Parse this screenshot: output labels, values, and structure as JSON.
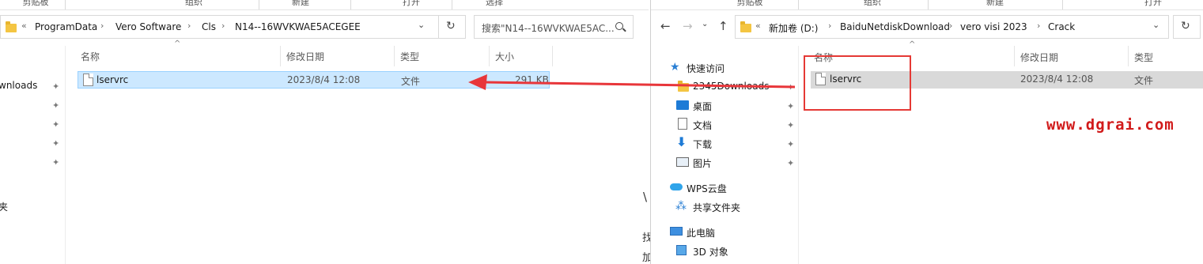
{
  "left_window": {
    "ribbon": [
      "剪贴板",
      "组织",
      "新建",
      "打开",
      "选择"
    ],
    "address": [
      "ProgramData",
      "Vero Software",
      "Cls",
      "N14--16WVKWAE5ACEGEE"
    ],
    "search_placeholder": "搜索\"N14--16WVKWAE5AC...",
    "columns": {
      "name": "名称",
      "date": "修改日期",
      "type": "类型",
      "size": "大小"
    },
    "row": {
      "name": "lservrc",
      "date": "2023/8/4 12:08",
      "type": "文件",
      "size": "291 KB"
    },
    "nav_partial": [
      "wnloads",
      "夹"
    ]
  },
  "right_window": {
    "ribbon": [
      "剪贴板",
      "组织",
      "新建",
      "打开"
    ],
    "address": [
      "新加卷 (D:)",
      "BaiduNetdiskDownload",
      "vero visi 2023",
      "Crack"
    ],
    "columns": {
      "name": "名称",
      "date": "修改日期",
      "type": "类型"
    },
    "row": {
      "name": "lservrc",
      "date": "2023/8/4 12:08",
      "type": "文件"
    },
    "nav": [
      "快速访问",
      "2345Downloads",
      "桌面",
      "文档",
      "下载",
      "图片",
      "WPS云盘",
      "共享文件夹",
      "此电脑",
      "3D 对象"
    ]
  },
  "between_fragments": [
    "\\",
    "找",
    "加"
  ],
  "watermark": "www.dgrai.com",
  "colors": {
    "selection_bg": "#cce8ff",
    "selection_border": "#99d1ff",
    "grey_selection": "#d9d9d9",
    "arrow_red": "#e8363a",
    "watermark_red": "#d11a1a",
    "highlight_box": "#e53935"
  },
  "icons": [
    "pin-icon",
    "folder-icon",
    "file-icon",
    "refresh-icon",
    "search-icon",
    "back-icon",
    "forward-icon",
    "up-icon",
    "chevron-down-icon",
    "star-icon",
    "desktop-icon",
    "document-icon",
    "download-icon",
    "picture-icon",
    "cloud-icon",
    "share-icon",
    "computer-icon",
    "cube-icon"
  ]
}
